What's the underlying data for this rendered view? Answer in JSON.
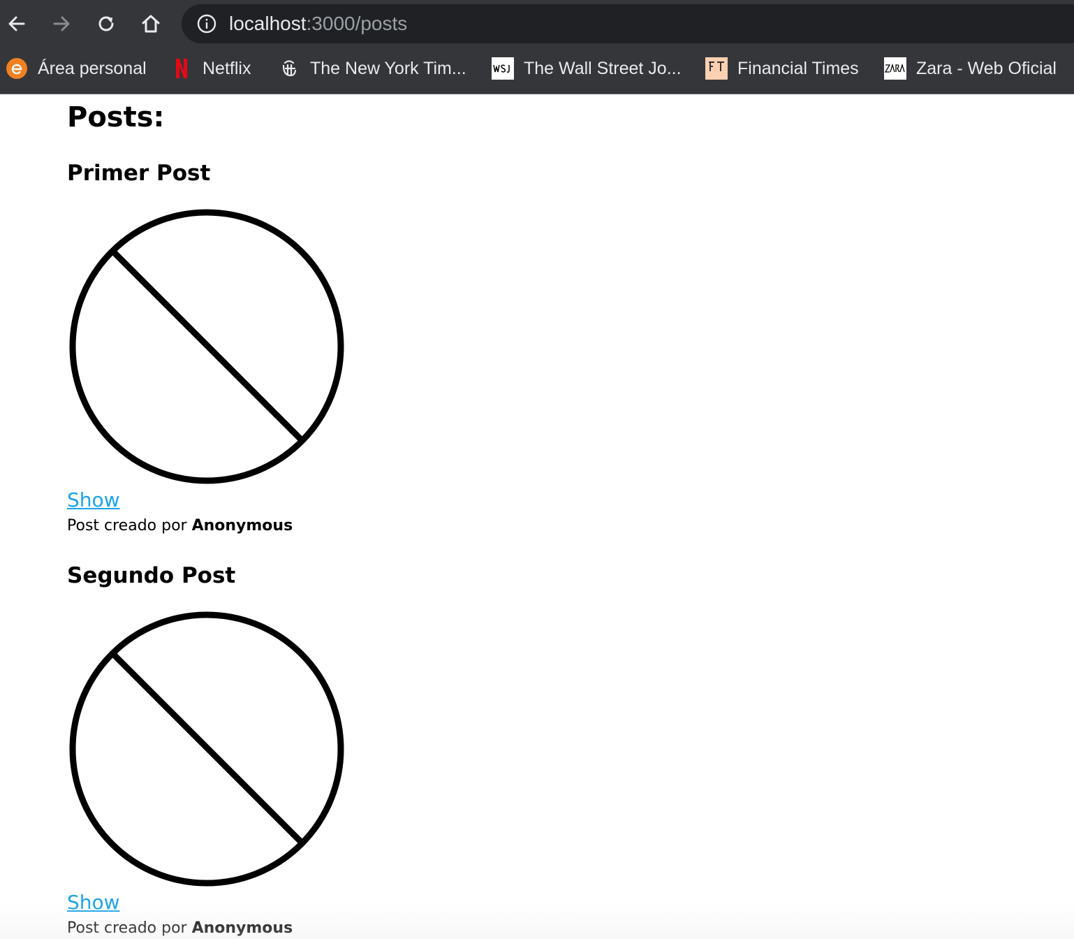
{
  "browser": {
    "address": {
      "host": "localhost",
      "path": ":3000/posts"
    },
    "nav_icons": [
      "back-arrow-icon",
      "forward-arrow-icon",
      "reload-icon",
      "home-icon",
      "info-icon"
    ],
    "bookmarks": [
      {
        "label": "Área personal",
        "icon": "e-orange-icon"
      },
      {
        "label": "Netflix",
        "icon": "netflix-icon"
      },
      {
        "label": "The New York Tim...",
        "icon": "nyt-icon"
      },
      {
        "label": "The Wall Street Jo...",
        "icon": "wsj-icon"
      },
      {
        "label": "Financial Times",
        "icon": "ft-icon"
      },
      {
        "label": "Zara - Web Oficial",
        "icon": "zara-icon"
      }
    ]
  },
  "page": {
    "title": "Posts:",
    "posts": [
      {
        "title": "Primer Post",
        "image_icon": "no-image-placeholder-icon",
        "show_label": "Show",
        "meta_prefix": "Post creado por ",
        "author": "Anonymous"
      },
      {
        "title": "Segundo Post",
        "image_icon": "no-image-placeholder-icon",
        "show_label": "Show",
        "meta_prefix": "Post creado por ",
        "author": "Anonymous"
      }
    ]
  },
  "colors": {
    "chrome_bg": "#35363a",
    "address_bg": "#202124",
    "link": "#1aa3e8",
    "netflix": "#e50914",
    "edge_orange": "#f08122",
    "ft_salmon": "#fcd0b1"
  }
}
